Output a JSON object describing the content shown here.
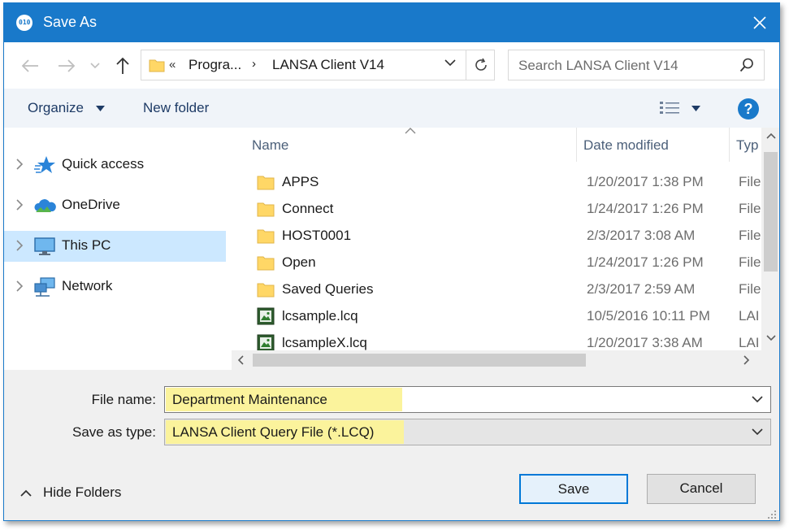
{
  "window": {
    "title": "Save As",
    "accent": "#1979ca"
  },
  "address": {
    "overflow_chevron": "«",
    "segments": [
      "Progra...",
      "LANSA Client V14"
    ],
    "separator": "›"
  },
  "search": {
    "placeholder": "Search LANSA Client V14"
  },
  "toolbar": {
    "organize": "Organize",
    "new_folder": "New folder",
    "help": "?"
  },
  "nav": {
    "items": [
      {
        "label": "Quick access",
        "icon": "quick-access-star-icon"
      },
      {
        "label": "OneDrive",
        "icon": "onedrive-cloud-icon"
      },
      {
        "label": "This PC",
        "icon": "this-pc-monitor-icon",
        "selected": true
      },
      {
        "label": "Network",
        "icon": "network-icon"
      }
    ]
  },
  "columns": {
    "name": "Name",
    "date": "Date modified",
    "type": "Typ"
  },
  "files": [
    {
      "name": "APPS",
      "date": "1/20/2017 1:38 PM",
      "type": "File",
      "kind": "folder"
    },
    {
      "name": "Connect",
      "date": "1/24/2017 1:26 PM",
      "type": "File",
      "kind": "folder"
    },
    {
      "name": "HOST0001",
      "date": "2/3/2017 3:08 AM",
      "type": "File",
      "kind": "folder"
    },
    {
      "name": "Open",
      "date": "1/24/2017 1:26 PM",
      "type": "File",
      "kind": "folder"
    },
    {
      "name": "Saved Queries",
      "date": "2/3/2017 2:59 AM",
      "type": "File",
      "kind": "folder"
    },
    {
      "name": "lcsample.lcq",
      "date": "10/5/2016 10:11 PM",
      "type": "LAI",
      "kind": "lcq"
    },
    {
      "name": "lcsampleX.lcq",
      "date": "1/20/2017 3:38 AM",
      "type": "LAI",
      "kind": "lcq"
    }
  ],
  "form": {
    "file_name_label": "File name:",
    "file_name_value": "Department Maintenance",
    "save_type_label": "Save as type:",
    "save_type_value": "LANSA Client Query File (*.LCQ)",
    "highlight_color": "#fbf39c"
  },
  "buttons": {
    "hide_folders": "Hide Folders",
    "save": "Save",
    "cancel": "Cancel"
  }
}
